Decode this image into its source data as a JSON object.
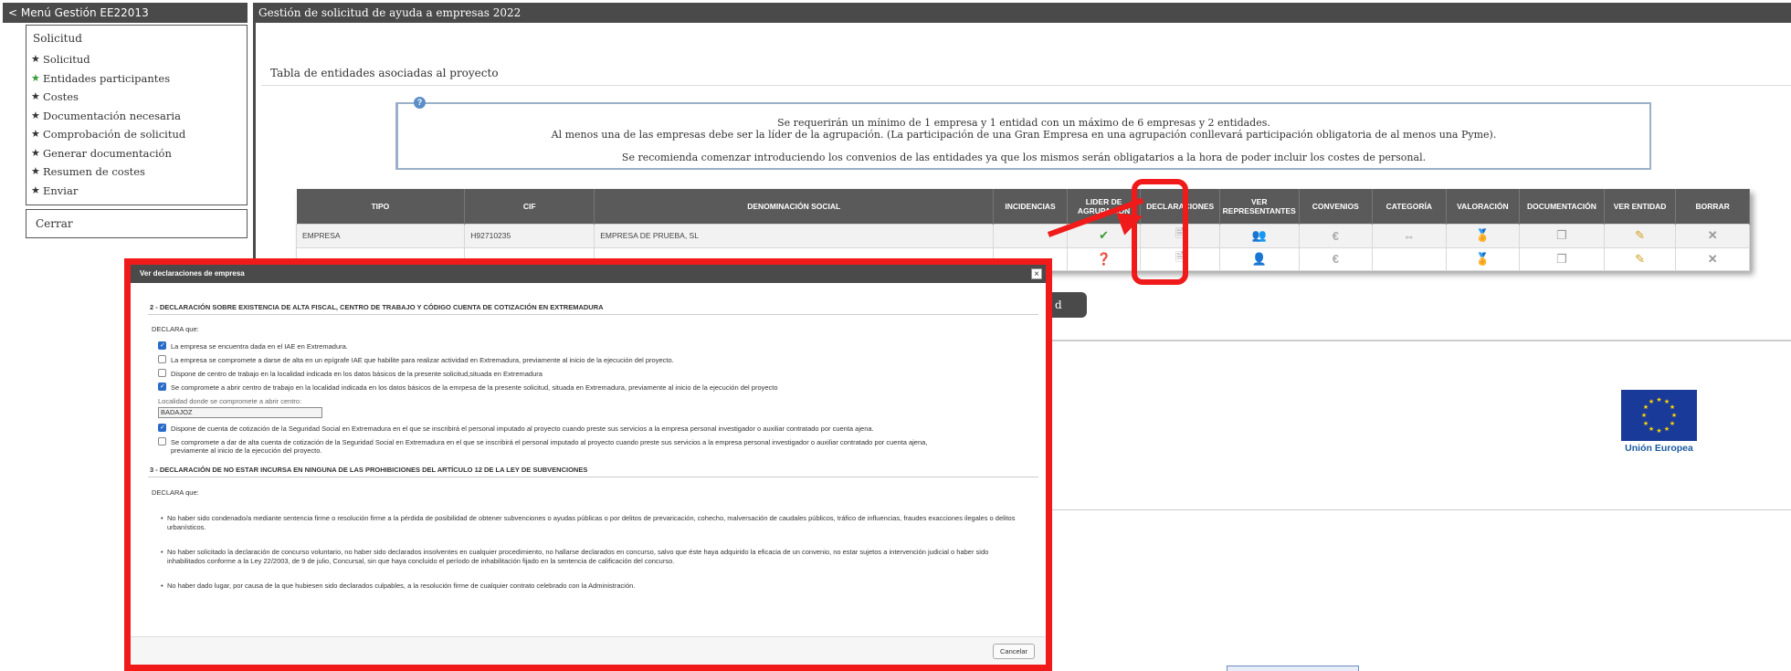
{
  "menu": {
    "header": "< Menú Gestión EE22013",
    "section_title": "Solicitud",
    "items": [
      {
        "label": "Solicitud",
        "star_color": "dark"
      },
      {
        "label": "Entidades participantes",
        "star_color": "green"
      },
      {
        "label": "Costes",
        "star_color": "dark"
      },
      {
        "label": "Documentación necesaria",
        "star_color": "dark"
      },
      {
        "label": "Comprobación de solicitud",
        "star_color": "dark"
      },
      {
        "label": "Generar documentación",
        "star_color": "dark"
      },
      {
        "label": "Resumen de costes",
        "star_color": "dark"
      },
      {
        "label": "Enviar",
        "star_color": "dark"
      }
    ],
    "close_label": "Cerrar"
  },
  "main": {
    "header": "Gestión de solicitud de ayuda a empresas 2022",
    "table_title": "Tabla de entidades asociadas al proyecto",
    "info": {
      "line1": "Se requerirán un mínimo de 1 empresa y 1 entidad con un máximo de 6 empresas y 2 entidades.",
      "line2": "Al menos una de las empresas debe ser la líder de la agrupación. (La participación de una Gran Empresa en una agrupación conllevará participación obligatoria de al menos una Pyme).",
      "line3": "Se recomienda comenzar introduciendo los convenios de las entidades ya que los mismos serán obligatarios a la hora de poder incluir los costes de personal."
    },
    "table": {
      "headers": [
        "TIPO",
        "CIF",
        "DENOMINACIÓN SOCIAL",
        "INCIDENCIAS",
        "LIDER DE AGRUPACIÓN",
        "DECLARACIONES",
        "VER REPRESENTANTES",
        "CONVENIOS",
        "CATEGORÍA",
        "VALORACIÓN",
        "DOCUMENTACIÓN",
        "VER ENTIDAD",
        "BORRAR"
      ],
      "rows": [
        {
          "tipo": "EMPRESA",
          "cif": "H92710235",
          "denominacion": "EMPRESA DE PRUEBA, SL",
          "incidencias": ""
        },
        {
          "tipo": "",
          "cif": "",
          "denominacion": "",
          "incidencias": ""
        }
      ]
    },
    "dark_button_label": "d",
    "eu_label": "Unión Europea"
  },
  "modal": {
    "title": "Ver declaraciones de empresa",
    "close": "×",
    "section2_title": "2 - DECLARACIÓN SOBRE EXISTENCIA DE ALTA FISCAL, CENTRO DE TRABAJO Y CÓDIGO CUENTA DE COTIZACIÓN EN EXTREMADURA",
    "declara": "DECLARA que:",
    "checks": [
      {
        "checked": true,
        "label": "La empresa se encuentra dada en el IAE en Extremadura."
      },
      {
        "checked": false,
        "label": "La empresa se compromete a darse de alta en un epígrafe IAE que habilite para realizar actividad en Extremadura, previamente al inicio de la ejecución del proyecto."
      },
      {
        "checked": false,
        "label": "Dispone de centro de trabajo en la localidad indicada en los datos básicos de la presente solicitud,situada en Extremadura"
      },
      {
        "checked": true,
        "label": "Se compromete a abrir centro de trabajo en la localidad indicada en los datos básicos de la emrpesa de la presente solicitud, situada en Extremadura, previamente al inicio de la ejecución del proyecto"
      }
    ],
    "localidad_label": "Localidad donde se compromete a abrir centro:",
    "localidad_value": "BADAJOZ",
    "checks2": [
      {
        "checked": true,
        "label": "Dispone de cuenta de cotización de la Seguridad Social en Extremadura en el que se inscribirá el personal imputado al proyecto cuando preste sus servicios a la empresa personal investigador o auxiliar contratado por cuenta ajena."
      },
      {
        "checked": false,
        "label": "Se compromete a dar de alta cuenta de cotización de la Seguridad Social en Extremadura en el que se inscribirá el personal imputado al proyecto cuando preste sus servicios a la empresa personal investigador o auxiliar contratado por cuenta ajena, previamente al inicio de la ejecución del proyecto."
      }
    ],
    "section3_title": "3 - DECLARACIÓN DE NO ESTAR INCURSA EN NINGUNA DE LAS PROHIBICIONES DEL ARTÍCULO 12 DE LA LEY DE SUBVENCIONES",
    "bullets": [
      "No haber sido condenado/a mediante sentencia firme o resolución firme a la pérdida de posibilidad de obtener subvenciones o ayudas públicas o por delitos de prevaricación, cohecho, malversación de caudales públicos, tráfico de influencias, fraudes exacciones ilegales o delitos urbanísticos.",
      "No haber solicitado la declaración de concurso voluntario, no haber sido declarados insolventes en cualquier procedimiento, no hallarse declarados en concurso, salvo que éste haya adquirido la eficacia de un convenio, no estar sujetos a intervención judicial o haber sido inhabilitados conforme a la Ley 22/2003, de 9 de julio, Concursal, sin que haya concluido el período de inhabilitación fijado en la sentencia de calificación del concurso.",
      "No haber dado lugar, por causa de la que hubiesen sido declarados culpables, a la resolución firme de cualquier contrato celebrado con la Administración."
    ],
    "cancel_label": "Cancelar"
  },
  "colors": {
    "header_bg": "#4a4a4a",
    "highlight": "#f01a1a",
    "eu_blue": "#1a3a99"
  }
}
